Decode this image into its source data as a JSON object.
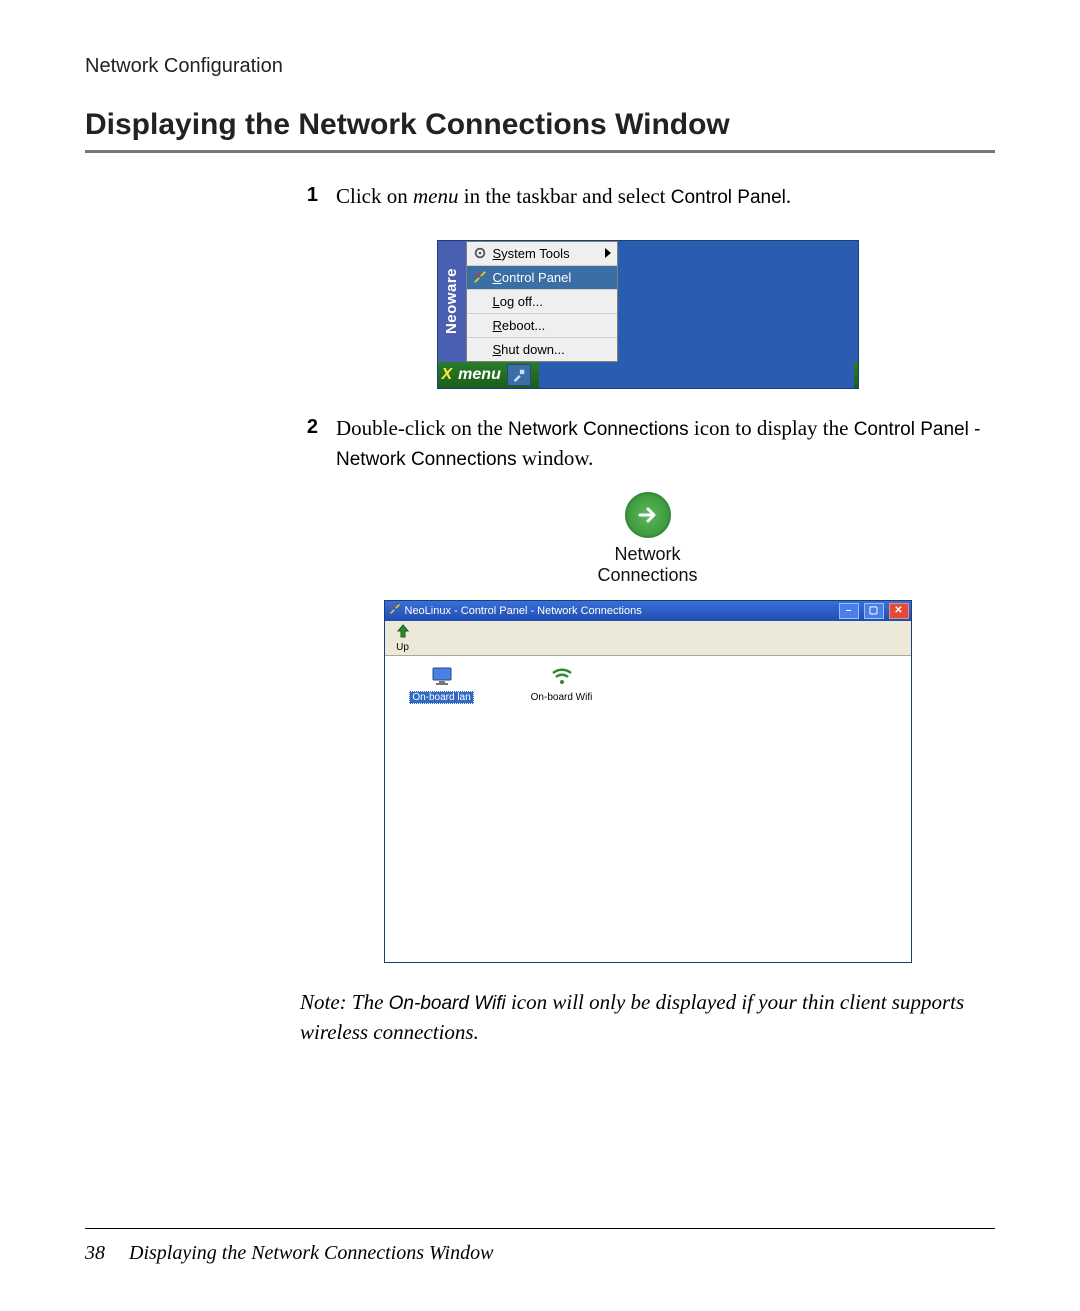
{
  "header": {
    "running_head": "Network Configuration",
    "title": "Displaying the Network Connections Window"
  },
  "steps": [
    {
      "num": "1",
      "pre": "Click on ",
      "em": "menu",
      "mid": " in the taskbar and select ",
      "code": "Control Panel",
      "post": "."
    },
    {
      "num": "2",
      "pre": "Double-click on the ",
      "code1": "Network Connections",
      "mid": " icon to display the ",
      "code2": "Control Panel - Network Connections",
      "post": " window."
    }
  ],
  "menu": {
    "brand": "Neoware",
    "items": {
      "system_tools": "System Tools",
      "control_panel": "Control Panel",
      "log_off": "Log off...",
      "reboot": "Reboot...",
      "shut_down": "Shut down..."
    },
    "taskbar_menu": "menu"
  },
  "net_icon": {
    "line1": "Network",
    "line2": "Connections"
  },
  "window": {
    "title": "NeoLinux - Control Panel - Network Connections",
    "toolbar": {
      "up": "Up"
    },
    "items": {
      "lan": "On-board lan",
      "wifi": "On-board Wifi"
    }
  },
  "note": {
    "prefix": "Note:  The ",
    "code": "On-board Wifi",
    "suffix": " icon will only be displayed if your thin client supports wireless connections."
  },
  "footer": {
    "page": "38",
    "title": "Displaying the Network Connections Window"
  }
}
